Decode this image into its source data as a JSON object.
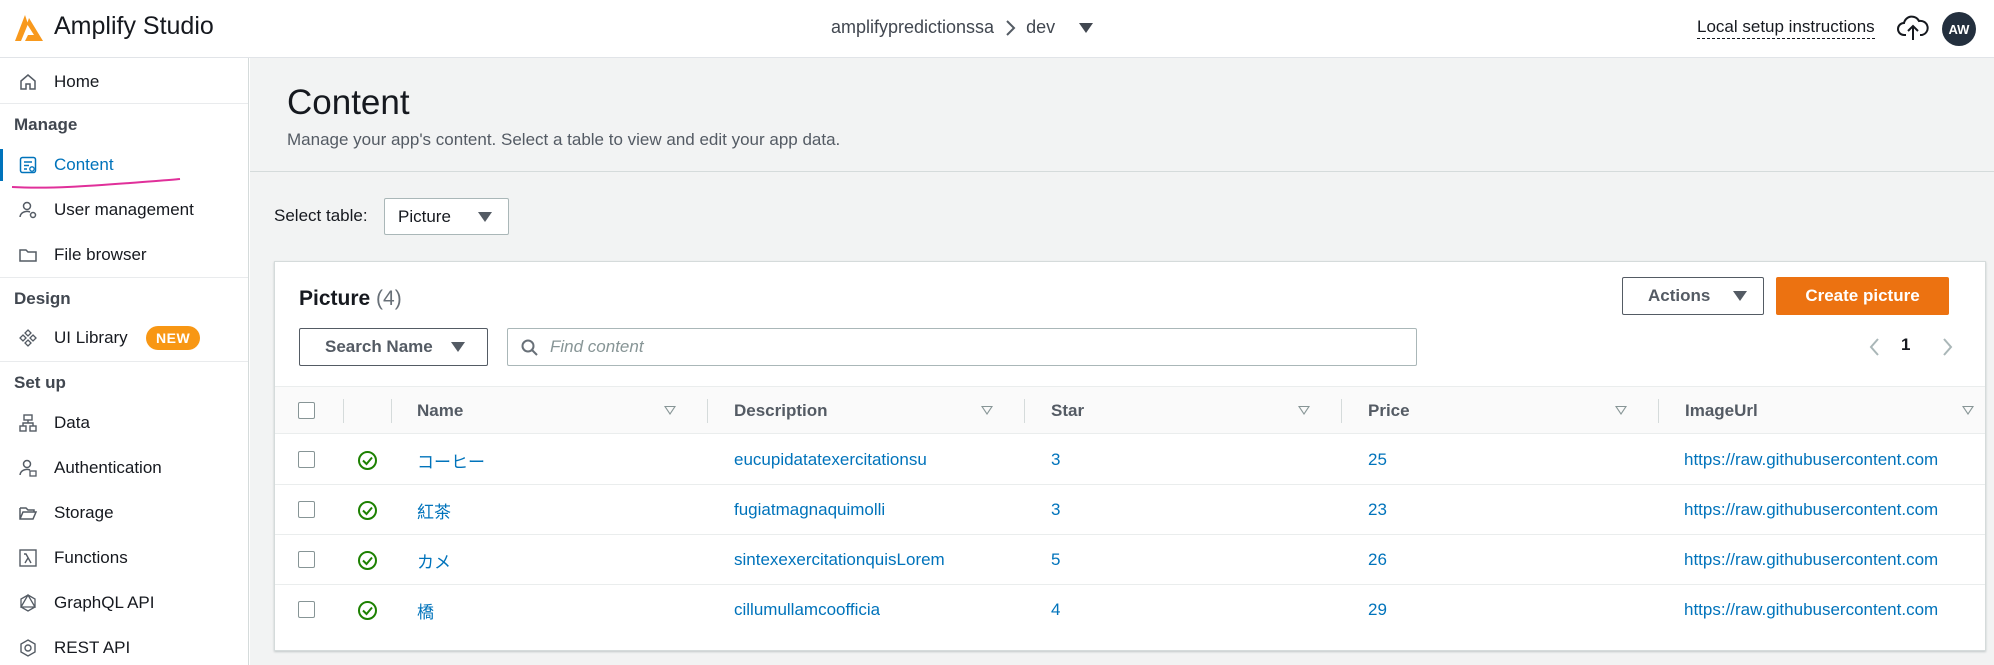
{
  "topbar": {
    "brand": "Amplify Studio",
    "project": "amplifypredictionssa",
    "environment": "dev",
    "local_setup": "Local setup instructions",
    "avatar_initials": "AW"
  },
  "sidebar": {
    "home": "Home",
    "sections": {
      "manage": "Manage",
      "design": "Design",
      "setup": "Set up"
    },
    "manage_items": [
      "Content",
      "User management",
      "File browser"
    ],
    "design_items": [
      "UI Library"
    ],
    "new_badge": "NEW",
    "setup_items": [
      "Data",
      "Authentication",
      "Storage",
      "Functions",
      "GraphQL API",
      "REST API"
    ],
    "active": "Content"
  },
  "page": {
    "title": "Content",
    "description": "Manage your app's content. Select a table to view and edit your app data.",
    "select_label": "Select table:",
    "selected_table": "Picture"
  },
  "panel": {
    "title": "Picture",
    "count": "(4)",
    "actions_label": "Actions",
    "create_label": "Create picture",
    "search_field_label": "Search Name",
    "find_placeholder": "Find content",
    "page_number": "1"
  },
  "table": {
    "columns": [
      "Name",
      "Description",
      "Star",
      "Price",
      "ImageUrl"
    ],
    "rows": [
      {
        "name": "コーヒー",
        "description": "eucupidatatexercitationsu",
        "star": "3",
        "price": "25",
        "imageurl": "https://raw.githubusercontent.com"
      },
      {
        "name": "紅茶",
        "description": "fugiatmagnaquimolli",
        "star": "3",
        "price": "23",
        "imageurl": "https://raw.githubusercontent.com"
      },
      {
        "name": "カメ",
        "description": "sintexexercitationquisLorem",
        "star": "5",
        "price": "26",
        "imageurl": "https://raw.githubusercontent.com"
      },
      {
        "name": "橋",
        "description": "cillumullamcoofficia",
        "star": "4",
        "price": "29",
        "imageurl": "https://raw.githubusercontent.com"
      }
    ]
  },
  "colors": {
    "accent": "#0073bb",
    "primary_button": "#ec7211",
    "badge": "#f89714",
    "status_ok": "#1d8102",
    "annotation_mark": "#e0309a"
  }
}
